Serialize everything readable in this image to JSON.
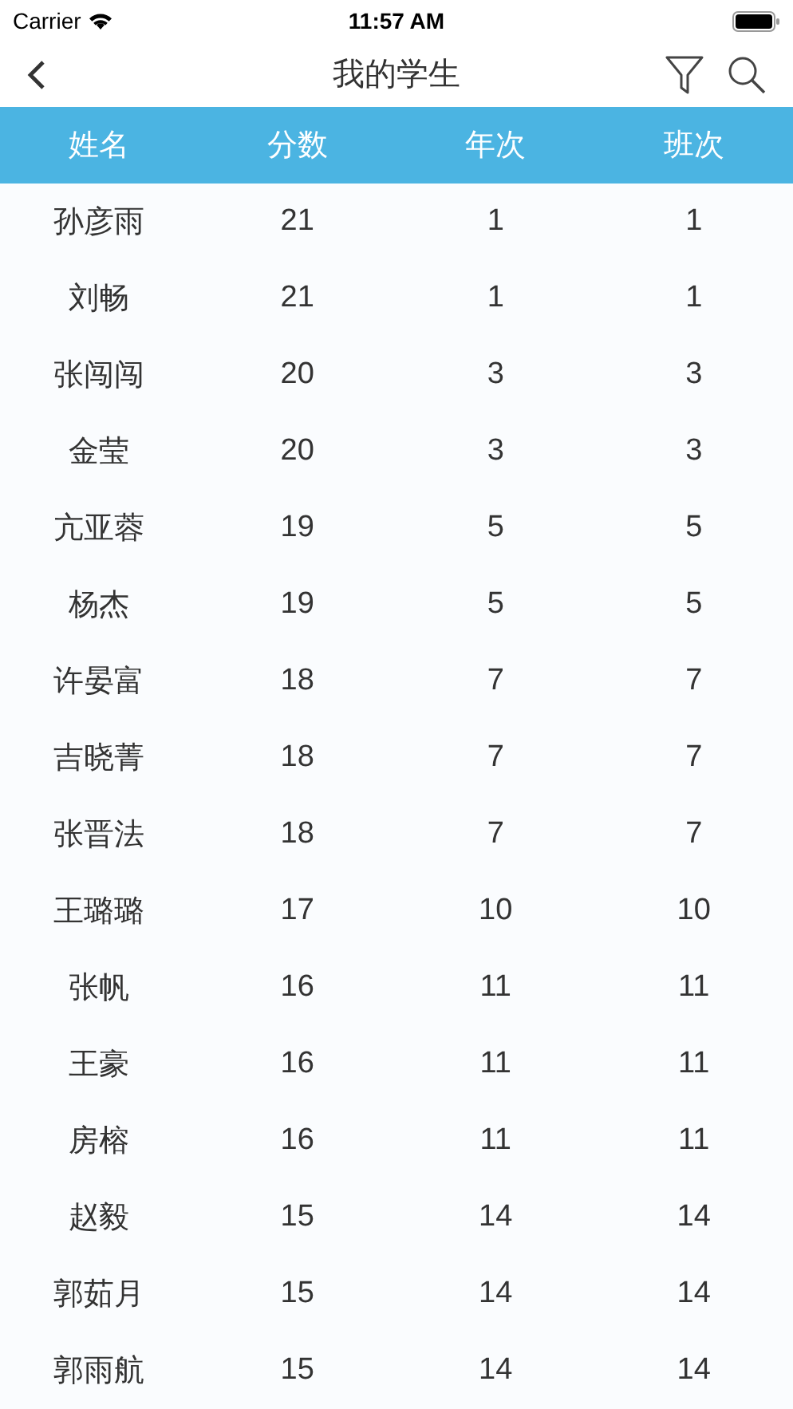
{
  "status_bar": {
    "carrier": "Carrier",
    "time": "11:57 AM"
  },
  "nav": {
    "title": "我的学生"
  },
  "table": {
    "columns": [
      "姓名",
      "分数",
      "年次",
      "班次"
    ],
    "rows": [
      [
        "孙彦雨",
        "21",
        "1",
        "1"
      ],
      [
        "刘畅",
        "21",
        "1",
        "1"
      ],
      [
        "张闯闯",
        "20",
        "3",
        "3"
      ],
      [
        "金莹",
        "20",
        "3",
        "3"
      ],
      [
        "亢亚蓉",
        "19",
        "5",
        "5"
      ],
      [
        "杨杰",
        "19",
        "5",
        "5"
      ],
      [
        "许晏富",
        "18",
        "7",
        "7"
      ],
      [
        "吉晓菁",
        "18",
        "7",
        "7"
      ],
      [
        "张晋法",
        "18",
        "7",
        "7"
      ],
      [
        "王璐璐",
        "17",
        "10",
        "10"
      ],
      [
        "张帆",
        "16",
        "11",
        "11"
      ],
      [
        "王豪",
        "16",
        "11",
        "11"
      ],
      [
        "房榕",
        "16",
        "11",
        "11"
      ],
      [
        "赵毅",
        "15",
        "14",
        "14"
      ],
      [
        "郭茹月",
        "15",
        "14",
        "14"
      ],
      [
        "郭雨航",
        "15",
        "14",
        "14"
      ]
    ]
  }
}
